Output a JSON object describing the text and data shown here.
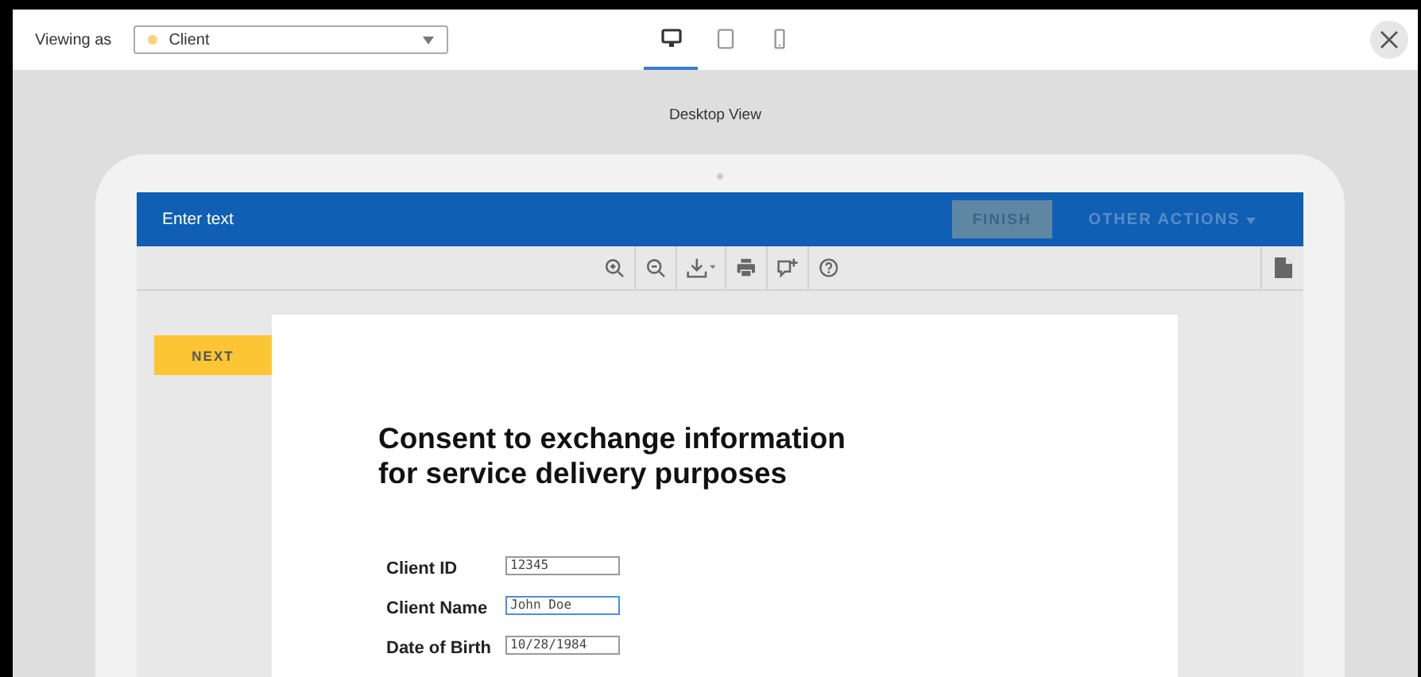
{
  "topbar": {
    "viewing_label": "Viewing as",
    "role_select": {
      "value": "Client",
      "color": "#fcd374"
    },
    "device_tabs": [
      {
        "kind": "desktop",
        "selected": true
      },
      {
        "kind": "tablet",
        "selected": false
      },
      {
        "kind": "phone",
        "selected": false
      }
    ]
  },
  "preview": {
    "title": "Desktop View"
  },
  "app": {
    "header": {
      "title": "Enter text",
      "finish": {
        "label": "FINISH",
        "disabled": true
      },
      "other_actions": "OTHER ACTIONS"
    },
    "toolbar": [
      {
        "kind": "zoom-in"
      },
      {
        "kind": "zoom-out"
      },
      {
        "kind": "download"
      },
      {
        "kind": "print"
      },
      {
        "kind": "comment"
      },
      {
        "kind": "help"
      }
    ],
    "next_button": "NEXT",
    "document": {
      "title_lines": [
        "Consent to exchange information",
        "for service delivery purposes"
      ],
      "fields": [
        {
          "label": "Client ID",
          "value": "12345",
          "focused": false
        },
        {
          "label": "Client Name",
          "value": "John Doe",
          "focused": true
        },
        {
          "label": "Date of Birth",
          "value": "10/28/1984",
          "focused": false
        }
      ]
    }
  }
}
